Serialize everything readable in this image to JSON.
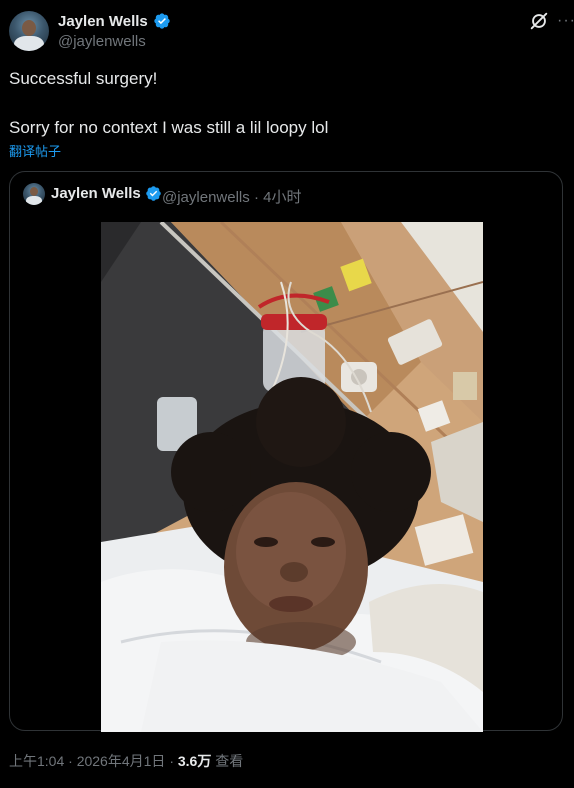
{
  "tweet": {
    "author_name": "Jaylen Wells",
    "author_handle": "@jaylenwells",
    "text_line_1": "Successful surgery!",
    "text_line_2": "Sorry for no context I was still a lil loopy lol",
    "translate_label": "翻译帖子",
    "menu_label": "···"
  },
  "quoted_tweet": {
    "author_name": "Jaylen Wells",
    "author_handle": "@jaylenwells",
    "separator": "·",
    "time_ago": "4小时"
  },
  "footer": {
    "time": "上午1:04",
    "sep1": "·",
    "date": "2026年4月1日",
    "sep2": "·",
    "views_count": "3.6万",
    "views_label": "查看"
  },
  "colors": {
    "background": "#000000",
    "text": "#e7e9ea",
    "muted": "#71767b",
    "accent": "#1d9bf0",
    "border": "#2f3336"
  },
  "icons": {
    "verified": "verified-badge-icon",
    "grok": "grok-icon",
    "more": "more-icon"
  }
}
